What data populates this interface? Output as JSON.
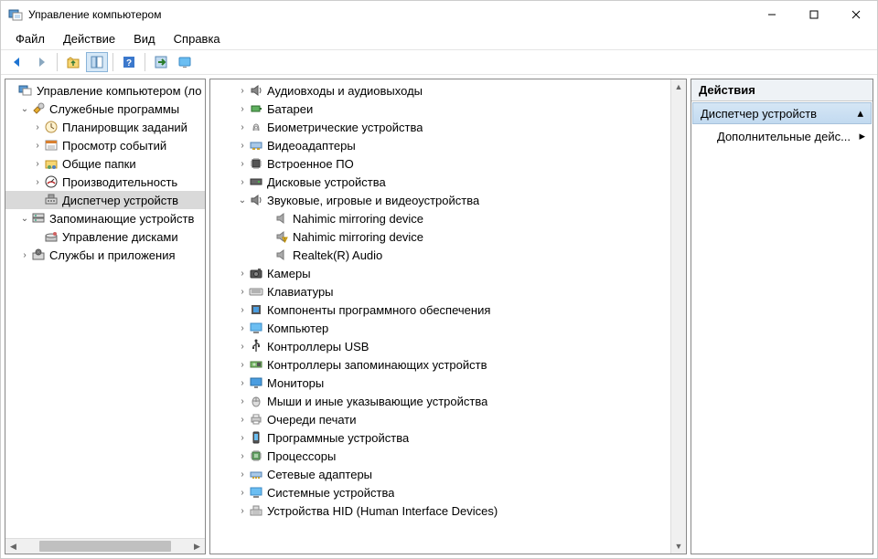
{
  "window": {
    "title": "Управление компьютером"
  },
  "menu": {
    "file": "Файл",
    "action": "Действие",
    "view": "Вид",
    "help": "Справка"
  },
  "nav": {
    "root": "Управление компьютером (ло",
    "sysTools": "Служебные программы",
    "sched": "Планировщик заданий",
    "eventViewer": "Просмотр событий",
    "sharedFolders": "Общие папки",
    "perf": "Производительность",
    "devmgr": "Диспетчер устройств",
    "storage": "Запоминающие устройств",
    "diskMgmt": "Управление дисками",
    "services": "Службы и приложения"
  },
  "dev": {
    "audioIO": "Аудиовходы и аудиовыходы",
    "batteries": "Батареи",
    "biometric": "Биометрические устройства",
    "display": "Видеоадаптеры",
    "firmware": "Встроенное ПО",
    "disk": "Дисковые устройства",
    "sound": "Звуковые, игровые и видеоустройства",
    "nahimic1": "Nahimic mirroring device",
    "nahimic2": "Nahimic mirroring device",
    "realtek": "Realtek(R) Audio",
    "cameras": "Камеры",
    "keyboards": "Клавиатуры",
    "swComponents": "Компоненты программного обеспечения",
    "computer": "Компьютер",
    "usb": "Контроллеры USB",
    "storageCtrl": "Контроллеры запоминающих устройств",
    "monitors": "Мониторы",
    "mice": "Мыши и иные указывающие устройства",
    "printQueues": "Очереди печати",
    "swDevices": "Программные устройства",
    "processors": "Процессоры",
    "netAdapters": "Сетевые адаптеры",
    "sysDevices": "Системные устройства",
    "hid": "Устройства HID (Human Interface Devices)"
  },
  "actions": {
    "header": "Действия",
    "category": "Диспетчер устройств",
    "more": "Дополнительные дейс..."
  }
}
